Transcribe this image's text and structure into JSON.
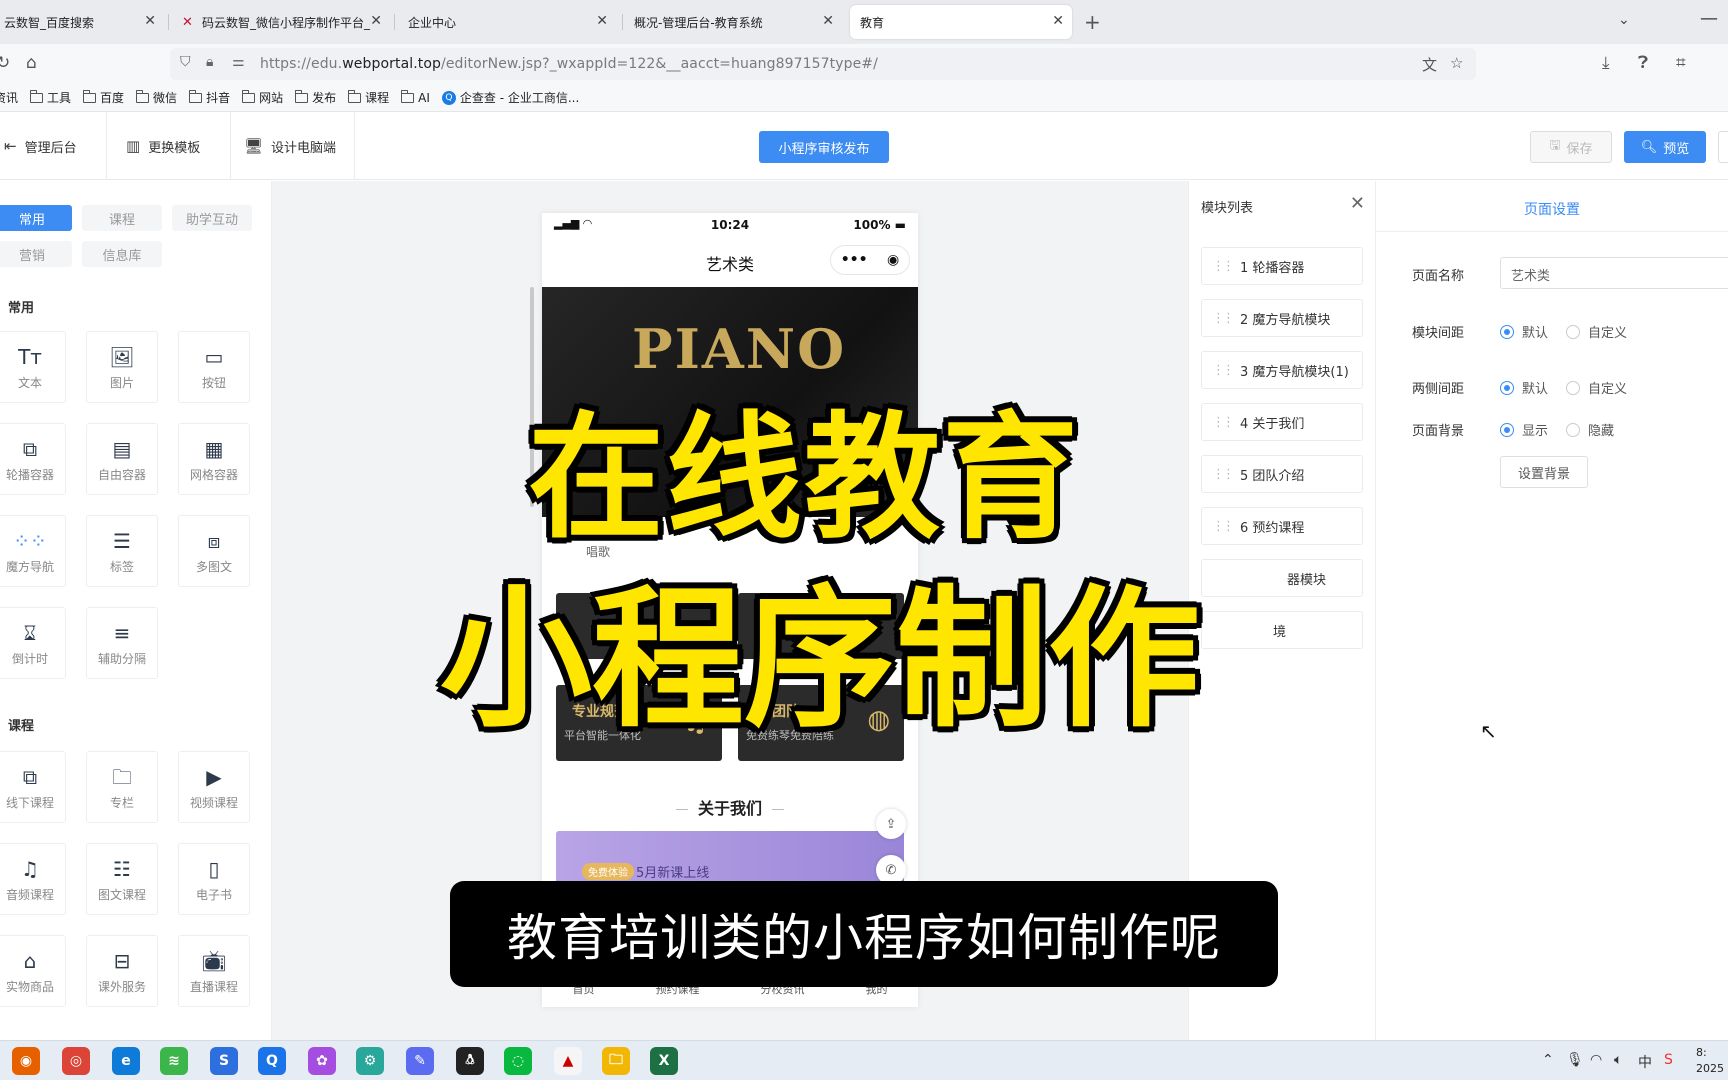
{
  "browser": {
    "tabs": [
      {
        "title": "云数智_百度搜索",
        "active": false
      },
      {
        "title": "码云数智_微信小程序制作平台_",
        "active": false
      },
      {
        "title": "企业中心",
        "active": false
      },
      {
        "title": "概况-管理后台-教育系统",
        "active": false
      },
      {
        "title": "教育",
        "active": true
      }
    ],
    "url_prefix": "https://edu.",
    "url_domain": "webportal.top",
    "url_path": "/editorNew.jsp?_wxappId=122&__aacct=huang897157type#/",
    "bookmarks": [
      "资讯",
      "工具",
      "百度",
      "微信",
      "抖音",
      "网站",
      "发布",
      "课程",
      "AI",
      "企查查 - 企业工商信..."
    ]
  },
  "toolbar": {
    "admin_label": "管理后台",
    "template_label": "更换模板",
    "pc_label": "设计电脑端",
    "publish_label": "小程序审核发布",
    "save_label": "保存",
    "preview_label": "预览"
  },
  "component_panel": {
    "tabs": [
      {
        "label": "常用",
        "active": true
      },
      {
        "label": "课程",
        "active": false
      },
      {
        "label": "助学互动",
        "active": false
      },
      {
        "label": "营销",
        "active": false
      },
      {
        "label": "信息库",
        "active": false
      }
    ],
    "group_common": "常用",
    "group_course": "课程",
    "common_items": [
      {
        "label": "文本",
        "icon": "text-icon"
      },
      {
        "label": "图片",
        "icon": "image-icon"
      },
      {
        "label": "按钮",
        "icon": "button-icon"
      },
      {
        "label": "轮播容器",
        "icon": "carousel-icon"
      },
      {
        "label": "自由容器",
        "icon": "free-container-icon"
      },
      {
        "label": "网格容器",
        "icon": "grid-icon"
      },
      {
        "label": "魔方导航",
        "icon": "cube-nav-icon"
      },
      {
        "label": "标签",
        "icon": "tag-icon"
      },
      {
        "label": "多图文",
        "icon": "multi-image-icon"
      },
      {
        "label": "倒计时",
        "icon": "hourglass-icon"
      },
      {
        "label": "辅助分隔",
        "icon": "divider-icon"
      }
    ],
    "course_items": [
      {
        "label": "线下课程",
        "icon": "offline-course-icon"
      },
      {
        "label": "专栏",
        "icon": "column-icon"
      },
      {
        "label": "视频课程",
        "icon": "video-icon"
      },
      {
        "label": "音频课程",
        "icon": "audio-icon"
      },
      {
        "label": "图文课程",
        "icon": "article-icon"
      },
      {
        "label": "电子书",
        "icon": "ebook-icon"
      },
      {
        "label": "实物商品",
        "icon": "shop-icon"
      },
      {
        "label": "课外服务",
        "icon": "service-icon"
      },
      {
        "label": "直播课程",
        "icon": "live-icon"
      }
    ]
  },
  "phone": {
    "time": "10:24",
    "battery": "100%",
    "title": "艺术类",
    "banner_text": "PIANO",
    "partial_label_left": "唱歌",
    "cards": [
      {
        "title": "专业规范",
        "sub": "平台智能一体化"
      },
      {
        "title": "团队",
        "sub": "免费练琴免费陪练"
      }
    ],
    "about_title": "关于我们",
    "about_tag": "免费体验",
    "about_text": "5月新课上线",
    "bottom_tabs": [
      "首页",
      "预约课程",
      "分校资讯",
      "我的"
    ]
  },
  "module_list": {
    "title": "模块列表",
    "items": [
      "1 轮播容器",
      "2 魔方导航模块",
      "3 魔方导航模块(1)",
      "4 关于我们",
      "5 团队介绍",
      "6 预约课程",
      "器模块",
      "境"
    ]
  },
  "page_settings": {
    "title": "页面设置",
    "name_label": "页面名称",
    "name_value": "艺术类",
    "module_gap_label": "模块间距",
    "side_gap_label": "两侧间距",
    "background_label": "页面背景",
    "opt_default": "默认",
    "opt_custom": "自定义",
    "opt_show": "显示",
    "opt_hide": "隐藏",
    "set_bg_button": "设置背景"
  },
  "overlay": {
    "headline_1": "在线教育",
    "headline_2": "小程序制作",
    "subtitle": "教育培训类的小程序如何制作呢"
  },
  "taskbar": {
    "ime": "中",
    "clock_line1": "8:",
    "clock_line2": "2025"
  },
  "colors": {
    "accent": "#3c8cf3",
    "headline": "#ffe600"
  }
}
